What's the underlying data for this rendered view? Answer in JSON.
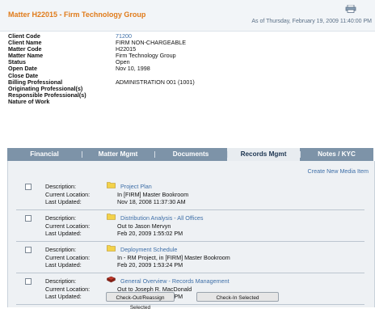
{
  "header": {
    "title": "Matter H22015 - Firm Technology Group",
    "as_of": "As of Thursday, February 19, 2009 11:40:00 PM",
    "print_icon": "printer-icon"
  },
  "info": [
    {
      "label": "Client Code",
      "value": "71200",
      "link": true
    },
    {
      "label": "Client Name",
      "value": "FIRM NON-CHARGEABLE"
    },
    {
      "label": "Matter Code",
      "value": "H22015"
    },
    {
      "label": "Matter Name",
      "value": "Firm Technology Group"
    },
    {
      "label": "Status",
      "value": "Open"
    },
    {
      "label": "Open Date",
      "value": "Nov 10, 1998"
    },
    {
      "label": "Close Date",
      "value": ""
    },
    {
      "label": "Billing Professional",
      "value": "ADMINISTRATION 001 (1001)"
    },
    {
      "label": "Originating Professional(s)",
      "value": ""
    },
    {
      "label": "Responsible Professional(s)",
      "value": ""
    },
    {
      "label": "Nature of Work",
      "value": ""
    }
  ],
  "tabs": [
    {
      "label": "Financial",
      "active": false
    },
    {
      "label": "Matter Mgmt",
      "active": false
    },
    {
      "label": "Documents",
      "active": false
    },
    {
      "label": "Records Mgmt",
      "active": true
    },
    {
      "label": "Notes / KYC",
      "active": false
    }
  ],
  "records": {
    "create_link": "Create New Media Item",
    "labels": {
      "description": "Description:",
      "location": "Current Location:",
      "updated": "Last Updated:"
    },
    "items": [
      {
        "icon": "folder-icon",
        "title": "Project Plan",
        "location": "In [FIRM] Master Bookroom",
        "updated": "Nov 18, 2008 11:37:30 AM"
      },
      {
        "icon": "folder-icon",
        "title": "Distribution Analysis - All Offices",
        "location": "Out to Jason Mervyn",
        "updated": "Feb 20, 2009 1:55:02 PM"
      },
      {
        "icon": "folder-icon",
        "title": "Deployment Schedule",
        "location": "In - RM Project, in [FIRM] Master Bookroom",
        "updated": "Feb 20, 2009 1:53:24 PM"
      },
      {
        "icon": "book-icon",
        "title": "General Overview - Records Management",
        "location": "Out to Joseph R. MacDonald",
        "updated": "Feb 20, 2009 2:15:49 PM"
      }
    ],
    "buttons": {
      "checkout": "Check-Out/Reassign Selected",
      "checkin": "Check-In Selected"
    }
  },
  "colors": {
    "title": "#e07b1a",
    "tab_bar": "#7d93a8",
    "link": "#3e6fa8",
    "folder": "#f3d24a"
  }
}
